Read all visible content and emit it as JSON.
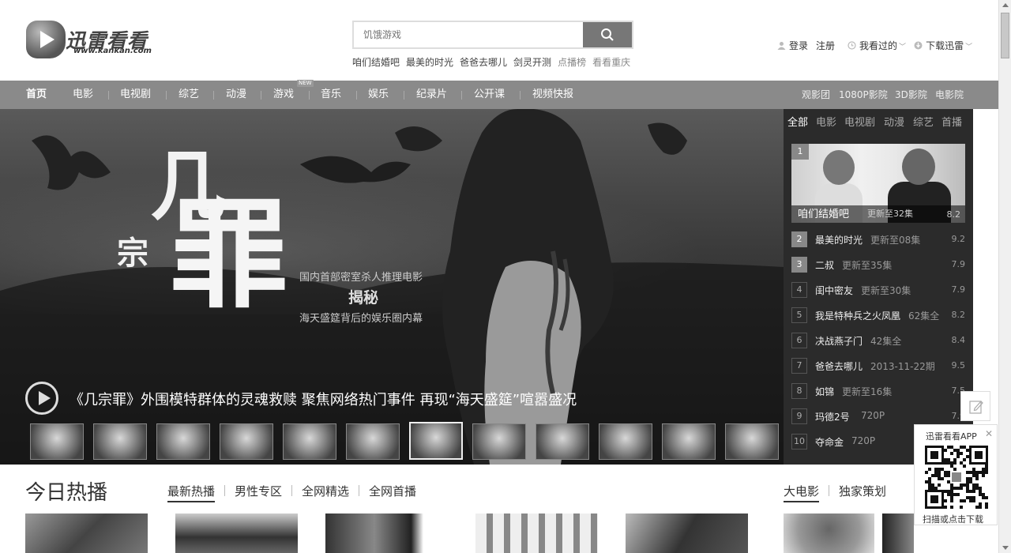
{
  "header": {
    "logo_text": "迅雷看看",
    "logo_sub": "www.kankan.com",
    "search_placeholder": "饥饿游戏",
    "hot_words": [
      {
        "label": "咱们结婚吧",
        "muted": false
      },
      {
        "label": "最美的时光",
        "muted": false
      },
      {
        "label": "爸爸去哪儿",
        "muted": false
      },
      {
        "label": "剑灵开测",
        "muted": false
      },
      {
        "label": "点播榜",
        "muted": true
      },
      {
        "label": "看看重庆",
        "muted": true
      }
    ],
    "login": "登录",
    "register": "注册",
    "history": "我看过的",
    "download": "下载迅雷"
  },
  "nav": {
    "items": [
      "首页",
      "电影",
      "电视剧",
      "综艺",
      "动漫",
      "游戏",
      "音乐",
      "娱乐",
      "纪录片",
      "公开课",
      "视频快报"
    ],
    "new_badge": "NEW",
    "right_items": [
      "观影团",
      "1080P影院",
      "3D影院",
      "电影院"
    ]
  },
  "hero": {
    "title_parts": [
      "几",
      "宗",
      "罪"
    ],
    "tagline_1": "国内首部密室杀人推理电影",
    "tagline_2": "揭秘",
    "tagline_3": "海天盛筵背后的娱乐圈内幕",
    "caption": "《几宗罪》外围模特群体的灵魂救赎 聚焦网络热门事件 再现“海天盛筵”喧嚣盛况",
    "thumb_count": 12,
    "active_thumb": 6
  },
  "ranking": {
    "tabs": [
      "全部",
      "电影",
      "电视剧",
      "动漫",
      "综艺",
      "首播"
    ],
    "featured": {
      "num": "1",
      "name": "咱们结婚吧",
      "update": "更新至32集",
      "score": "8.2"
    },
    "rows": [
      {
        "num": "2",
        "name": "最美的时光",
        "update": "更新至08集",
        "score": "9.2",
        "hot": true
      },
      {
        "num": "3",
        "name": "二叔",
        "update": "更新至35集",
        "score": "7.9",
        "hot": true
      },
      {
        "num": "4",
        "name": "闺中密友",
        "update": "更新至30集",
        "score": "7.9",
        "hot": false
      },
      {
        "num": "5",
        "name": "我是特种兵之火凤凰",
        "update": "62集全",
        "score": "8.2",
        "hot": false
      },
      {
        "num": "6",
        "name": "决战燕子门",
        "update": "42集全",
        "score": "8.4",
        "hot": false
      },
      {
        "num": "7",
        "name": "爸爸去哪儿",
        "update": "2013-11-22期",
        "score": "9.5",
        "hot": false
      },
      {
        "num": "8",
        "name": "如锦",
        "update": "更新至16集",
        "score": "7.5",
        "hot": false
      },
      {
        "num": "9",
        "name": "玛德2号",
        "update": "720P",
        "score": "7.9",
        "hot": false
      },
      {
        "num": "10",
        "name": "夺命金",
        "update": "720P",
        "score": "",
        "hot": false
      }
    ]
  },
  "app_box": {
    "title": "迅雷看看APP",
    "footer": "扫描或点击下载"
  },
  "today": {
    "title": "今日热播",
    "tabs": [
      "最新热播",
      "男性专区",
      "全网精选",
      "全网首播"
    ],
    "right_tabs": [
      "大电影",
      "独家策划"
    ]
  },
  "colors": {
    "nav_bg": "#8a8a8a",
    "rank_bg": "#2b2b2b"
  }
}
